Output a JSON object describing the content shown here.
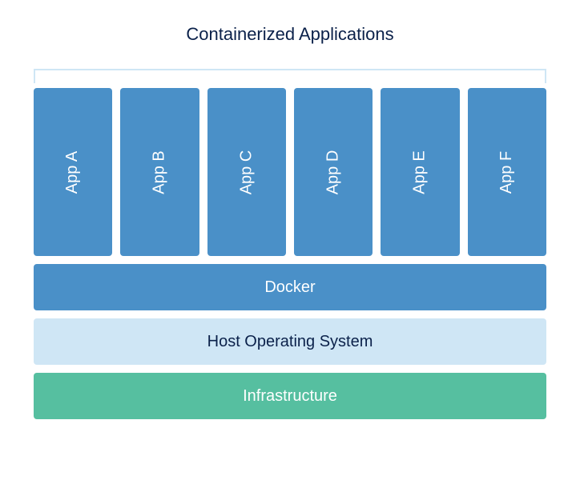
{
  "title": "Containerized Applications",
  "apps": [
    {
      "label": "App A"
    },
    {
      "label": "App B"
    },
    {
      "label": "App C"
    },
    {
      "label": "App D"
    },
    {
      "label": "App E"
    },
    {
      "label": "App F"
    }
  ],
  "layers": {
    "docker": "Docker",
    "host": "Host Operating System",
    "infrastructure": "Infrastructure"
  },
  "colors": {
    "app_box": "#4a90c8",
    "docker": "#4a90c8",
    "host": "#cfe6f5",
    "infra": "#56bfa0",
    "title_text": "#0b214a"
  }
}
